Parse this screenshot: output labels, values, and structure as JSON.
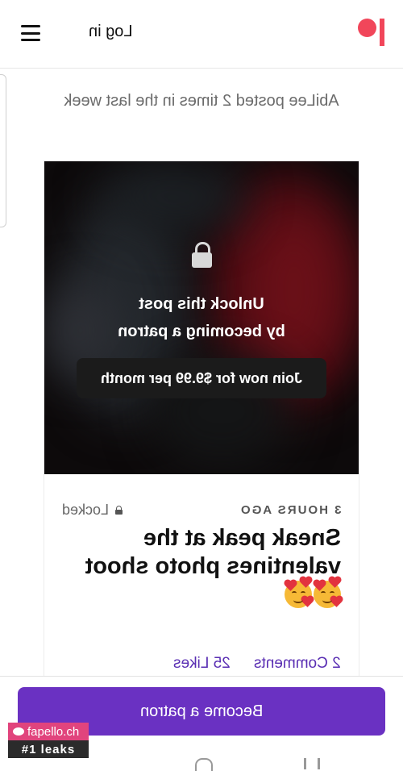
{
  "header": {
    "login_label": "Log in",
    "menu_icon": "hamburger-menu-icon",
    "logo_icon": "patreon-logo",
    "brand_color": "#f1465a"
  },
  "activity": {
    "text": "AbiLee posted 2 times in the last week"
  },
  "post": {
    "unlock_line1": "Unlock this post",
    "unlock_line2": "by becoming a patron",
    "join_label": "Join now for $9.99 per month",
    "time_ago": "3 HOURS AGO",
    "locked_label": "Locked",
    "title": "Sneak peak at the valentines photo shoot",
    "emoji": [
      "smiling-face-with-hearts",
      "smiling-face-with-hearts"
    ],
    "comments_label": "2 Comments",
    "likes_label": "25 Likes",
    "accent_color": "#5a2fb3"
  },
  "footer": {
    "become_patron_label": "Become a patron",
    "button_color": "#6a31c2"
  },
  "watermark": {
    "site": "fapello.ch",
    "tagline": "#1 leaks"
  }
}
